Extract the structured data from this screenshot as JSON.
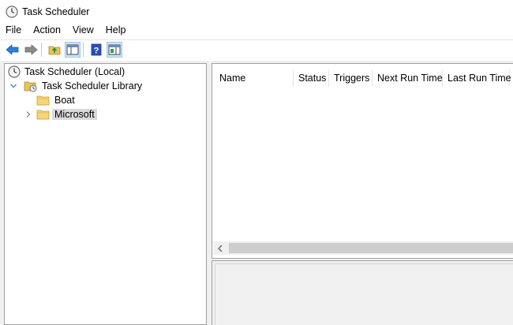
{
  "window": {
    "title": "Task Scheduler"
  },
  "menu": [
    "File",
    "Action",
    "View",
    "Help"
  ],
  "toolbar": {
    "buttons": [
      "back-arrow-icon",
      "forward-arrow-icon",
      "folder-up-icon",
      "show-hide-console-tree-icon",
      "help-icon",
      "show-hide-action-pane-icon"
    ]
  },
  "tree": {
    "root": "Task Scheduler (Local)",
    "library": "Task Scheduler Library",
    "children": [
      "Boat",
      "Microsoft"
    ]
  },
  "task_list": {
    "columns": [
      "Name",
      "Status",
      "Triggers",
      "Next Run Time",
      "Last Run Time"
    ]
  },
  "colors": {
    "selected_bg": "#d9d9d9",
    "toolbar_active": "#cce4f7",
    "tree_chevron": "#3c8fd4"
  }
}
